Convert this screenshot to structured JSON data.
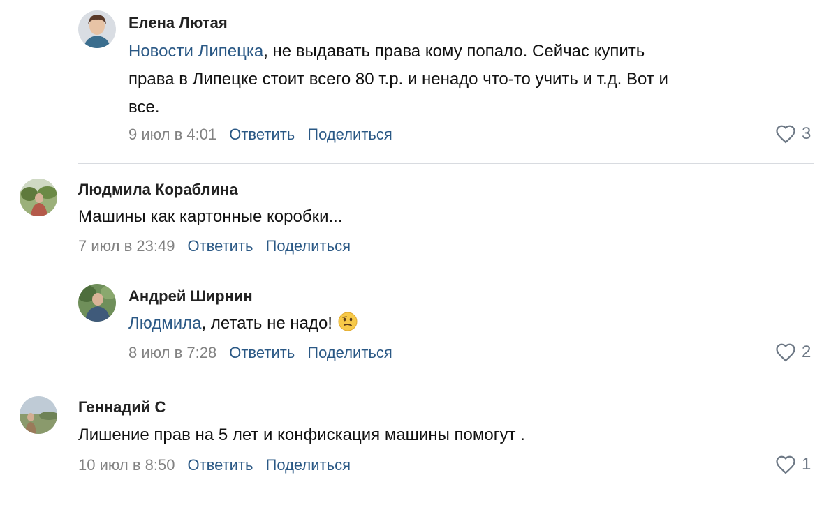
{
  "comments": [
    {
      "author": "Елена Лютая",
      "mention": "Новости Липецка",
      "text_line1_rest": ", не выдавать права кому попало. Сейчас купить",
      "text_line2": "права в Липецке стоит всего 80 т.р. и ненадо что-то учить и т.д. Вот и",
      "text_line3": "все.",
      "date": "9 июл в 4:01",
      "reply_label": "Ответить",
      "share_label": "Поделиться",
      "likes": "3"
    },
    {
      "author": "Людмила Кораблина",
      "text": "Машины как картонные коробки...",
      "date": "7 июл в 23:49",
      "reply_label": "Ответить",
      "share_label": "Поделиться"
    },
    {
      "author": "Андрей Ширнин",
      "mention": "Людмила",
      "text_rest": ", летать не надо!",
      "emoji_icon": "confused-face-icon",
      "date": "8 июл в 7:28",
      "reply_label": "Ответить",
      "share_label": "Поделиться",
      "likes": "2"
    },
    {
      "author": "Геннадий С",
      "text": "Лишение прав на 5 лет и конфискация машины помогут .",
      "date": "10 июл в 8:50",
      "reply_label": "Ответить",
      "share_label": "Поделиться",
      "likes": "1"
    }
  ],
  "colors": {
    "link": "#2a5885",
    "meta": "#828282",
    "divider": "#d8dbe0"
  }
}
